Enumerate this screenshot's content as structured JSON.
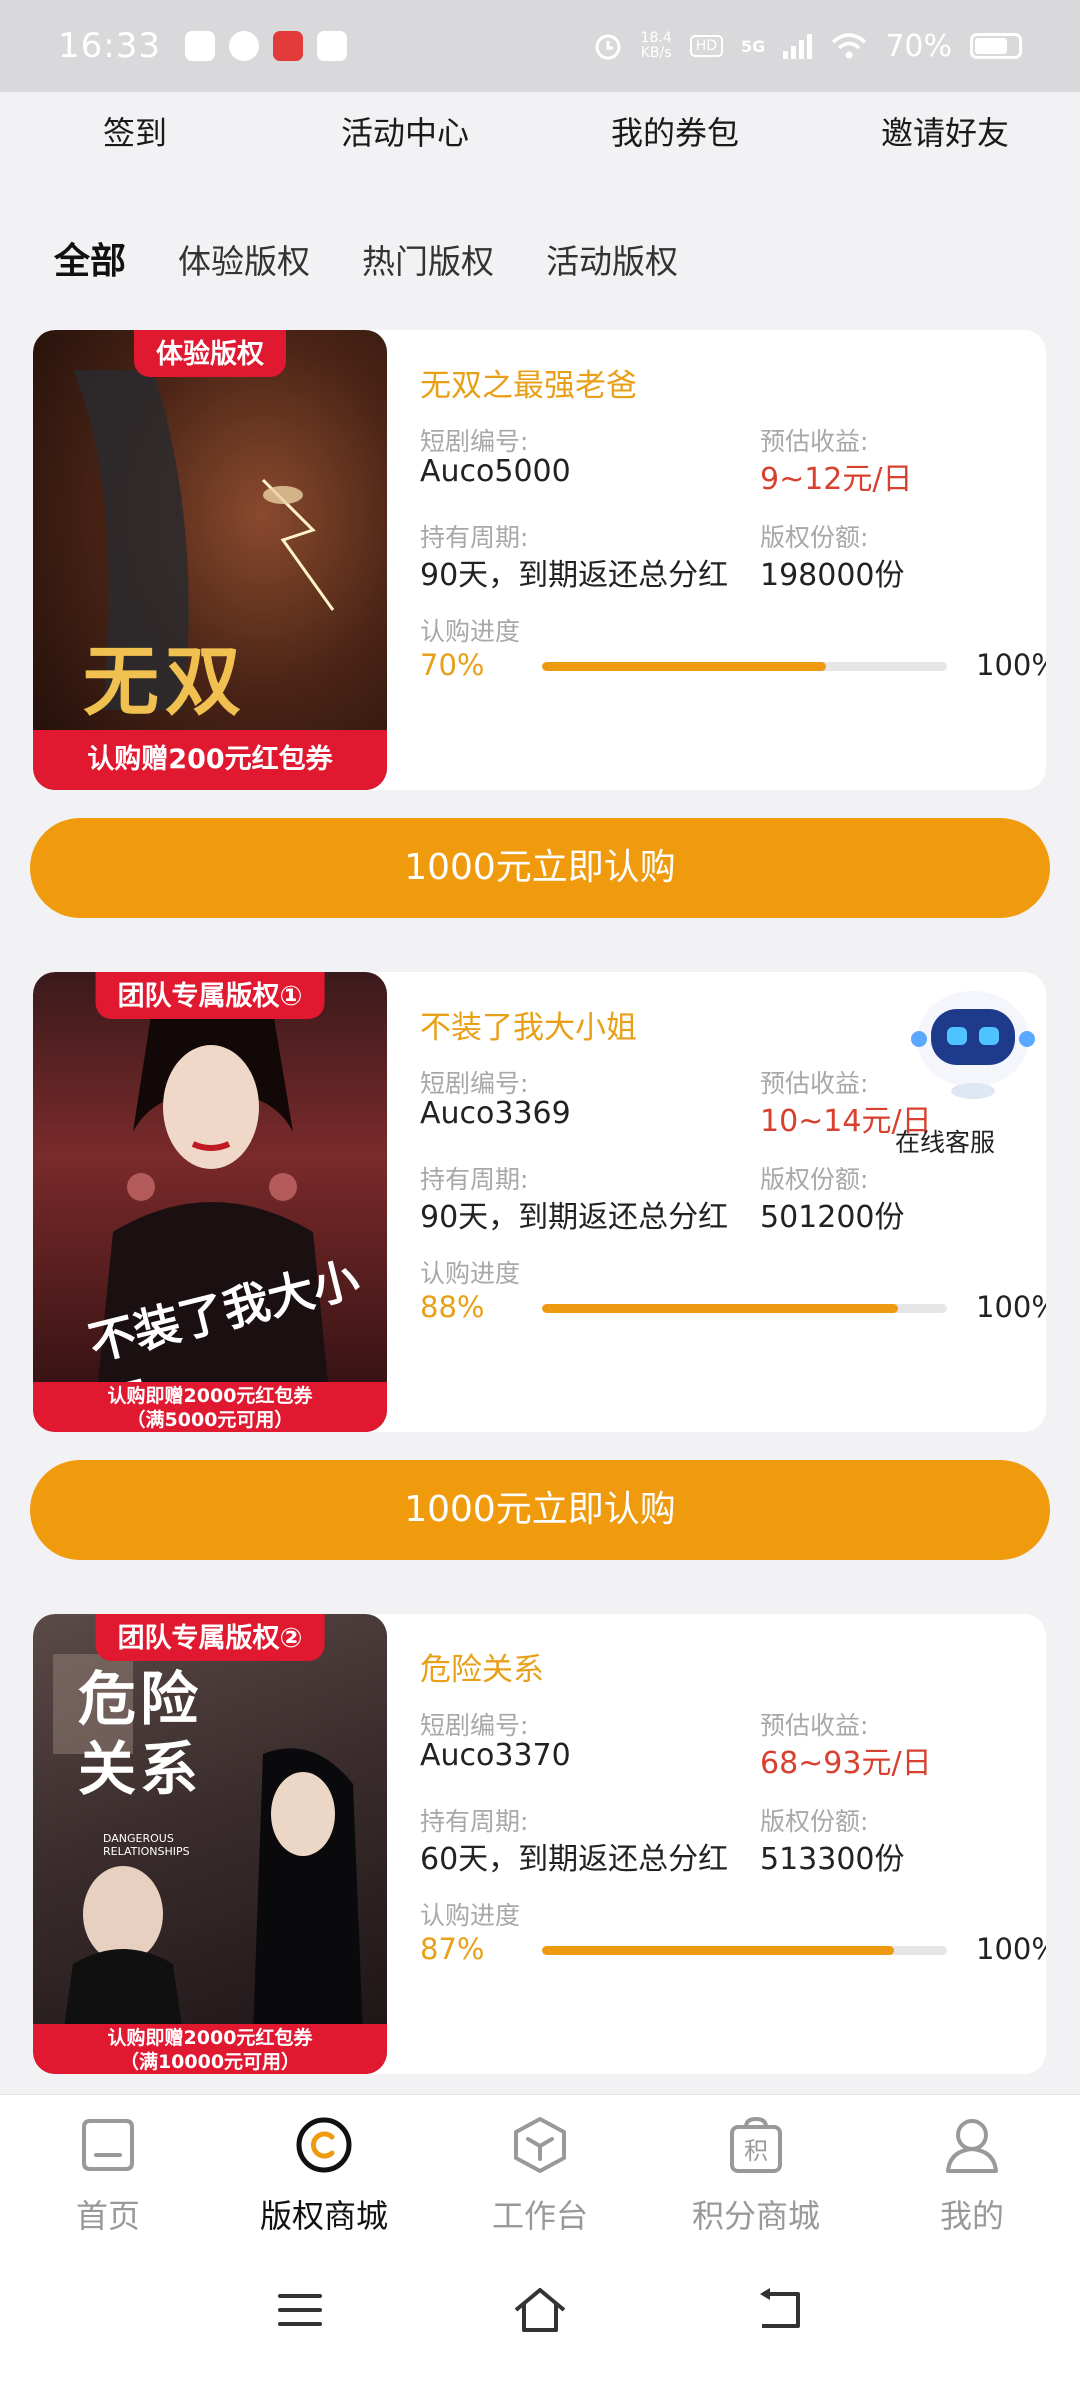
{
  "status_bar": {
    "time": "16:33",
    "net_speed_value": "18.4",
    "net_speed_unit": "KB/s",
    "hd": "HD",
    "network": "5G",
    "battery": "70%"
  },
  "quick_nav": [
    "签到",
    "活动中心",
    "我的券包",
    "邀请好友"
  ],
  "categories": [
    "全部",
    "体验版权",
    "热门版权",
    "活动版权"
  ],
  "labels": {
    "drama_code": "短剧编号:",
    "est_income": "预估收益:",
    "hold_period": "持有周期:",
    "share_amount": "版权份额:",
    "progress": "认购进度",
    "max_progress": "100%"
  },
  "cards": [
    {
      "badge": "体验版权",
      "poster_title": "无双",
      "poster_footer": "认购赠200元红包券",
      "title": "无双之最强老爸",
      "code": "Auco5000",
      "income": "9~12元/日",
      "period": "90天，到期返还总分红",
      "shares": "198000份",
      "progress_label": "70%",
      "progress": 70,
      "button": "1000元立即认购"
    },
    {
      "badge": "团队专属版权①",
      "poster_title": "不装了我大小姐",
      "poster_footer_line1": "认购即赠2000元红包券",
      "poster_footer_line2": "（满5000元可用）",
      "title": "不装了我大小姐",
      "code": "Auco3369",
      "income": "10~14元/日",
      "period": "90天，到期返还总分红",
      "shares": "501200份",
      "progress_label": "88%",
      "progress": 88,
      "button": "1000元立即认购"
    },
    {
      "badge": "团队专属版权②",
      "poster_title": "危险关系",
      "poster_subtitle": "DANGEROUS RELATIONSHIPS",
      "poster_footer_line1": "认购即赠2000元红包券",
      "poster_footer_line2": "（满10000元可用）",
      "title": "危险关系",
      "code": "Auco3370",
      "income": "68~93元/日",
      "period": "60天，到期返还总分红",
      "shares": "513300份",
      "progress_label": "87%",
      "progress": 87
    }
  ],
  "service": {
    "label": "在线客服"
  },
  "tabbar": [
    {
      "label": "首页",
      "icon": "home-icon"
    },
    {
      "label": "版权商城",
      "icon": "copyright-mall-icon"
    },
    {
      "label": "工作台",
      "icon": "workbench-icon"
    },
    {
      "label": "积分商城",
      "icon": "points-mall-icon",
      "glyph": "积"
    },
    {
      "label": "我的",
      "icon": "profile-icon"
    }
  ],
  "colors": {
    "accent": "#f09a0e",
    "title_orange": "#e8a018",
    "income_red": "#d8402f",
    "poster_red": "#e01830"
  }
}
